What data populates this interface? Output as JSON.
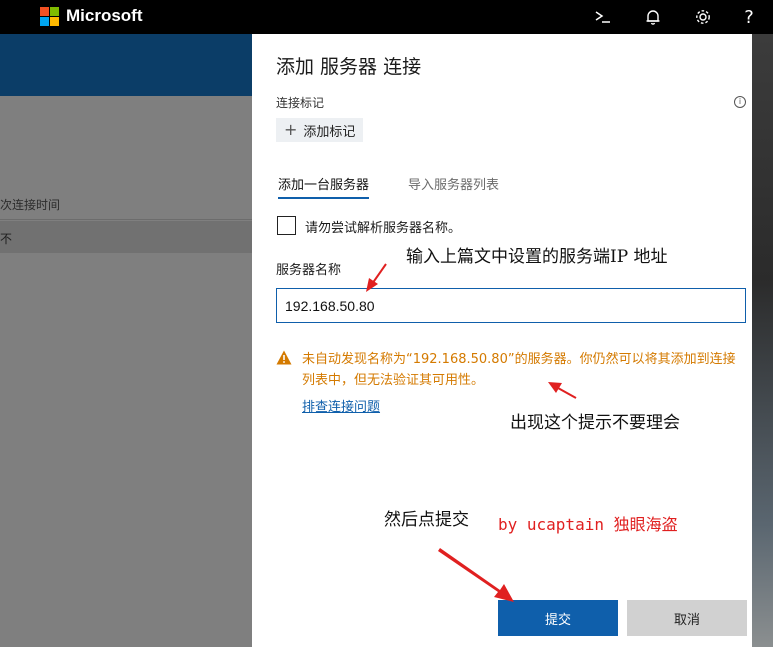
{
  "topbar": {
    "brand": "Microsoft",
    "icons": [
      "terminal-icon",
      "bell-icon",
      "gear-icon",
      "help-icon"
    ],
    "help_glyph": "?"
  },
  "background": {
    "column_header": "次连接时间",
    "row_cell": "不"
  },
  "panel": {
    "title": "添加 服务器 连接",
    "tags_label": "连接标记",
    "add_tag_label": "添加标记",
    "tabs": [
      "添加一台服务器",
      "导入服务器列表"
    ],
    "checkbox_label": "请勿尝试解析服务器名称。",
    "checkbox_checked": false,
    "server_name_label": "服务器名称",
    "server_name_value": "192.168.50.80",
    "warning_text": "未自动发现名称为“192.168.50.80”的服务器。你仍然可以将其添加到连接列表中，但无法验证其可用性。",
    "troubleshoot_link": "排查连接问题",
    "submit_label": "提交",
    "cancel_label": "取消"
  },
  "annotations": {
    "server_hint": "输入上篇文中设置的服务端IP 地址",
    "warning_hint": "出现这个提示不要理会",
    "submit_hint": "然后点提交",
    "author": "by ucaptain 独眼海盗"
  },
  "colors": {
    "accent": "#0f5fab",
    "warning": "#d47a00",
    "annotation_red": "#e02020"
  }
}
